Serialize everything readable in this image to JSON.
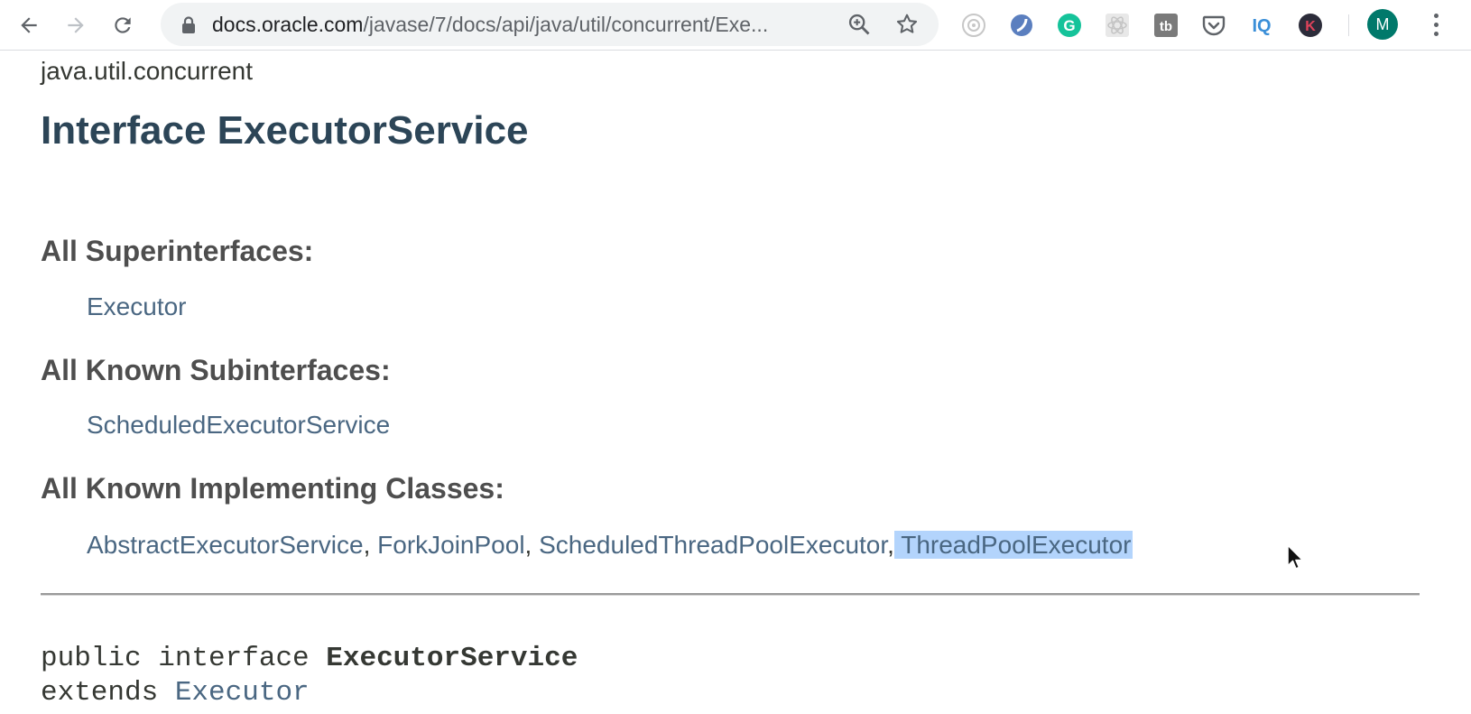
{
  "browser": {
    "url_host": "docs.oracle.com",
    "url_path": "/javase/7/docs/api/java/util/concurrent/Exe...",
    "extensions": [
      "camera-extension-icon",
      "vpn-extension-icon",
      "grammarly-icon",
      "react-devtools-icon",
      "tb-extension-icon",
      "pocket-icon",
      "iq-extension-icon",
      "k-extension-icon"
    ],
    "avatar_letter": "M",
    "iq_label": "IQ",
    "tb_label": "tb",
    "k_label": "K",
    "g_label": "G"
  },
  "page": {
    "package": "java.util.concurrent",
    "title": "Interface ExecutorService",
    "superinterfaces_label": "All Superinterfaces:",
    "superinterfaces": [
      "Executor"
    ],
    "subinterfaces_label": "All Known Subinterfaces:",
    "subinterfaces": [
      "ScheduledExecutorService"
    ],
    "implementing_label": "All Known Implementing Classes:",
    "implementing": [
      "AbstractExecutorService",
      "ForkJoinPool",
      "ScheduledThreadPoolExecutor",
      "ThreadPoolExecutor"
    ],
    "separator": ",",
    "signature": {
      "line1_prefix": "public interface ",
      "line1_name": "ExecutorService",
      "line2_prefix": "extends ",
      "line2_link": "Executor"
    }
  },
  "colors": {
    "title": "#2c4557",
    "link": "#4a6782",
    "selection": "#b3d4fc"
  }
}
